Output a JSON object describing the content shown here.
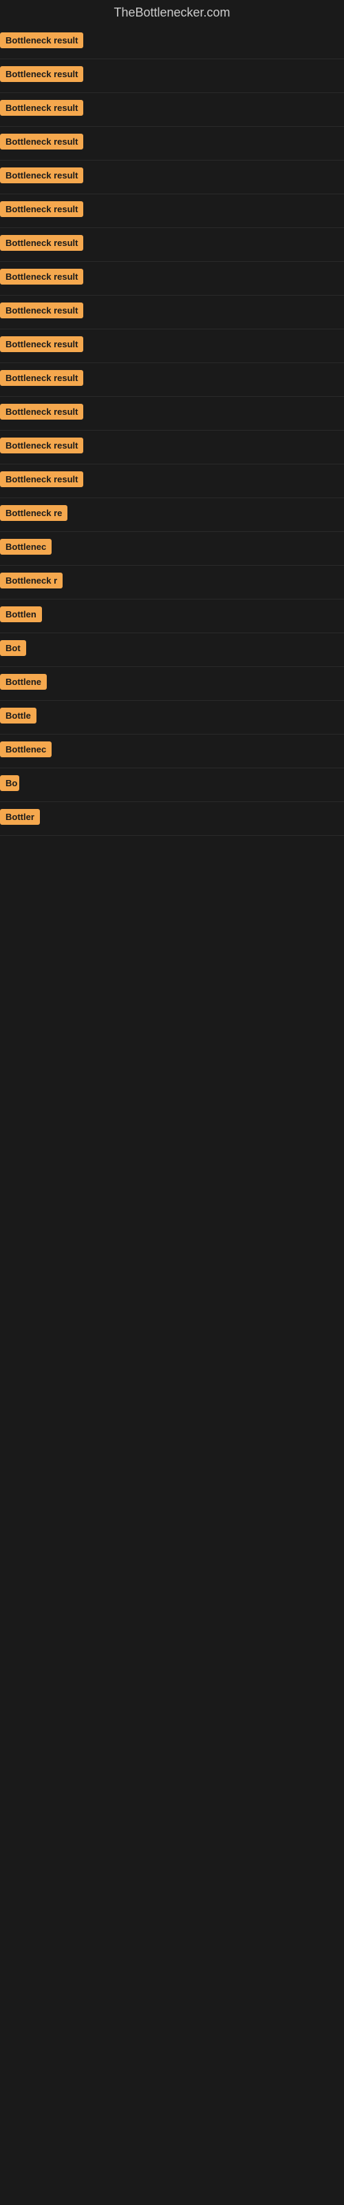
{
  "site": {
    "title": "TheBottlenecker.com"
  },
  "results": [
    {
      "label": "Bottleneck result",
      "width": 155
    },
    {
      "label": "Bottleneck result",
      "width": 155
    },
    {
      "label": "Bottleneck result",
      "width": 155
    },
    {
      "label": "Bottleneck result",
      "width": 155
    },
    {
      "label": "Bottleneck result",
      "width": 155
    },
    {
      "label": "Bottleneck result",
      "width": 155
    },
    {
      "label": "Bottleneck result",
      "width": 155
    },
    {
      "label": "Bottleneck result",
      "width": 155
    },
    {
      "label": "Bottleneck result",
      "width": 155
    },
    {
      "label": "Bottleneck result",
      "width": 155
    },
    {
      "label": "Bottleneck result",
      "width": 155
    },
    {
      "label": "Bottleneck result",
      "width": 155
    },
    {
      "label": "Bottleneck result",
      "width": 155
    },
    {
      "label": "Bottleneck result",
      "width": 155
    },
    {
      "label": "Bottleneck re",
      "width": 115
    },
    {
      "label": "Bottlenec",
      "width": 85
    },
    {
      "label": "Bottleneck r",
      "width": 100
    },
    {
      "label": "Bottlen",
      "width": 70
    },
    {
      "label": "Bot",
      "width": 40
    },
    {
      "label": "Bottlene",
      "width": 78
    },
    {
      "label": "Bottle",
      "width": 60
    },
    {
      "label": "Bottlenec",
      "width": 85
    },
    {
      "label": "Bo",
      "width": 28
    },
    {
      "label": "Bottler",
      "width": 65
    }
  ]
}
